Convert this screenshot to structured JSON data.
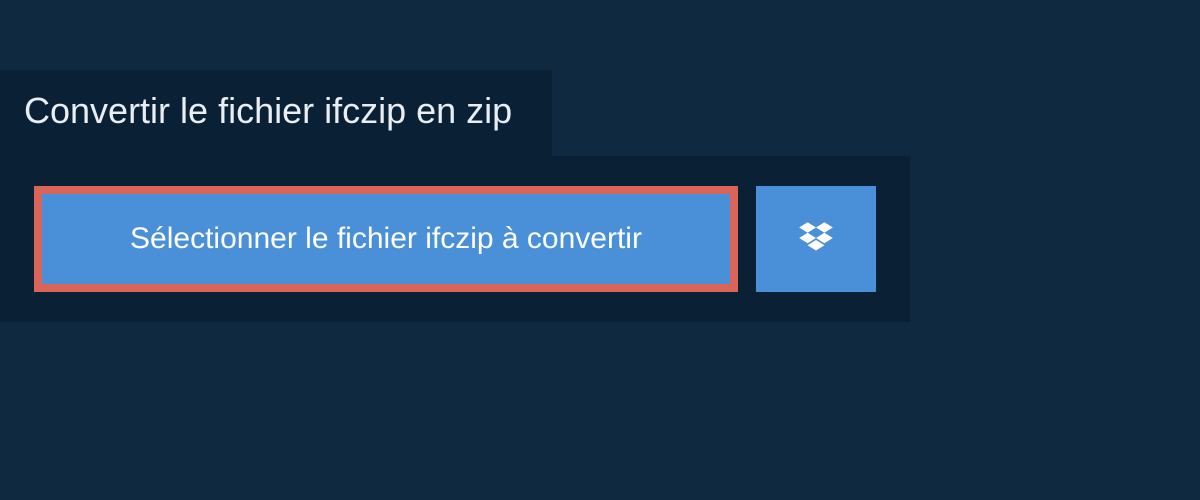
{
  "header": {
    "title": "Convertir le fichier ifczip en zip"
  },
  "actions": {
    "select_file_label": "Sélectionner le fichier ifczip à convertir"
  }
}
